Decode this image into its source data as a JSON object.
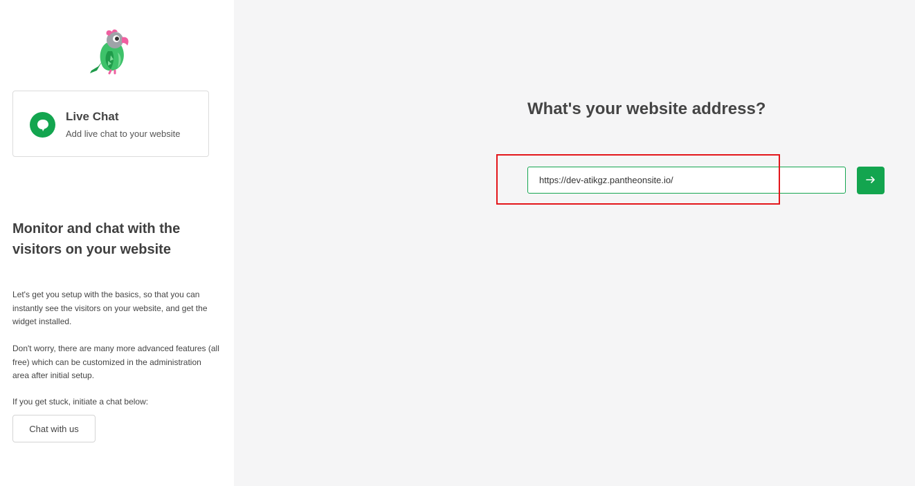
{
  "sidebar": {
    "logo_icon": "parrot-logo-icon",
    "product": {
      "icon": "chat-bubble-icon",
      "title": "Live Chat",
      "subtitle": "Add live chat to your website"
    },
    "heading": "Monitor and chat with the visitors on your website",
    "paragraph_1": "Let's get you setup with the basics, so that you can instantly see the visitors on your website, and get the widget installed.",
    "paragraph_2": "Don't worry, there are many more advanced features (all free) which can be customized in the administration area after initial setup.",
    "paragraph_3": "If you get stuck, initiate a chat below:",
    "chat_button_label": "Chat with us"
  },
  "main": {
    "title": "What's your website address?",
    "url_input": {
      "value": "https://dev-atikgz.pantheonsite.io/"
    },
    "submit_icon": "arrow-right-icon"
  },
  "colors": {
    "accent": "#13a54f",
    "highlight": "#e3151a",
    "background": "#f5f5f6"
  }
}
